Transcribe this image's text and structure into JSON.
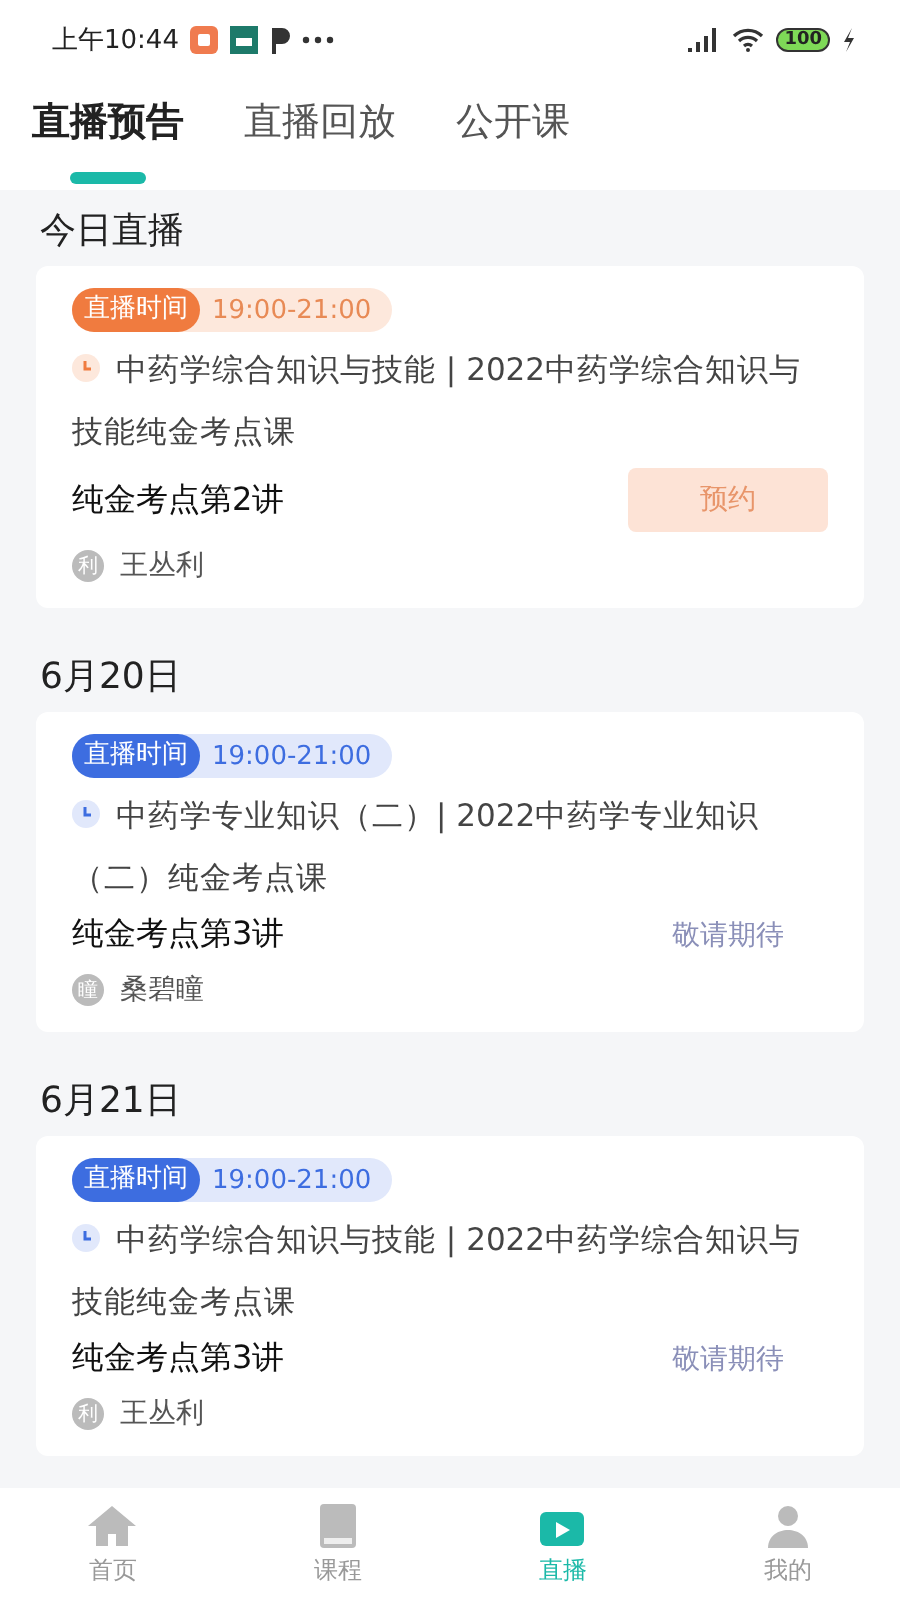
{
  "status_bar": {
    "time": "上午10:44",
    "battery": "100"
  },
  "tabs": [
    {
      "label": "直播预告",
      "selected": true
    },
    {
      "label": "直播回放",
      "selected": false
    },
    {
      "label": "公开课",
      "selected": false
    }
  ],
  "sections": [
    {
      "heading": "今日直播",
      "items": [
        {
          "kind": "orange",
          "tag": "直播时间",
          "time": "19:00-21:00",
          "title": "中药学综合知识与技能 | 2022中药学综合知识与技能纯金考点课",
          "action": {
            "kind": "button",
            "label": "预约"
          },
          "lesson": "纯金考点第2讲",
          "avatar": "利",
          "teacher": "王丛利"
        }
      ]
    },
    {
      "heading": "6月20日",
      "items": [
        {
          "kind": "blue",
          "tag": "直播时间",
          "time": "19:00-21:00",
          "title": "中药学专业知识（二）| 2022中药学专业知识（二）纯金考点课",
          "action": {
            "kind": "text",
            "label": "敬请期待"
          },
          "lesson": "纯金考点第3讲",
          "avatar": "瞳",
          "teacher": "桑碧瞳"
        }
      ]
    },
    {
      "heading": "6月21日",
      "items": [
        {
          "kind": "blue",
          "tag": "直播时间",
          "time": "19:00-21:00",
          "title": "中药学综合知识与技能 | 2022中药学综合知识与技能纯金考点课",
          "action": {
            "kind": "text",
            "label": "敬请期待"
          },
          "lesson": "纯金考点第3讲",
          "avatar": "利",
          "teacher": "王丛利"
        }
      ]
    }
  ],
  "nav": [
    {
      "label": "首页",
      "selected": false
    },
    {
      "label": "课程",
      "selected": false
    },
    {
      "label": "直播",
      "selected": true
    },
    {
      "label": "我的",
      "selected": false
    }
  ]
}
